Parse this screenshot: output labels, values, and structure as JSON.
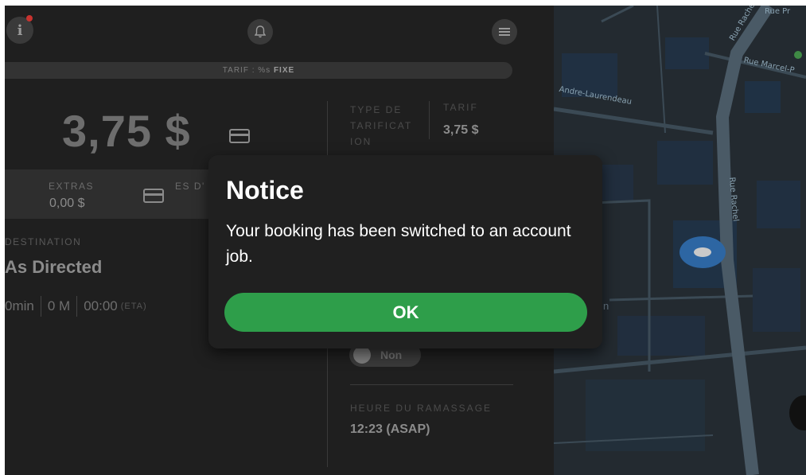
{
  "header": {
    "info_icon": "info-icon",
    "info_glyph": "i",
    "bell_icon": "bell-icon",
    "menu_icon": "menu-icon"
  },
  "tariff_bar": {
    "prefix": "TARIF : %s ",
    "mode": "FIXE"
  },
  "fare": {
    "amount": "3,75 $",
    "icon": "credit-card-icon"
  },
  "extras": {
    "label": "EXTRAS",
    "value": "0,00 $",
    "icon": "credit-card-icon",
    "truncated_label": "ES D'"
  },
  "destination": {
    "label": "DESTINATION",
    "value": "As Directed",
    "duration": "0min",
    "distance": "0 M",
    "eta_time": "00:00",
    "eta_label": "(ETA)"
  },
  "pricing": {
    "type_label": "TYPE DE TARIFICAT ION",
    "tarif_label": "TARIF",
    "tarif_value": "3,75 $"
  },
  "toggle": {
    "label": "Non"
  },
  "pickup": {
    "label": "HEURE DU RAMASSAGE",
    "value": "12:23 (ASAP)"
  },
  "map": {
    "streets": {
      "laurendeau": "Andre-Laurendeau",
      "marcel": "Rue Marcel-P",
      "rachel_top": "Rue Rachel",
      "rue_top": "Rue Pr",
      "rachel": "Rue Rachel"
    },
    "hidden_text": "n",
    "colors": {
      "land": "#252a2f",
      "road": "#3b4a55",
      "block": "#1f3247",
      "location": "#2d66a3"
    }
  },
  "dialog": {
    "title": "Notice",
    "message": "Your booking has been switched to an account job.",
    "ok_label": "OK",
    "ok_color": "#2e9e4a"
  }
}
